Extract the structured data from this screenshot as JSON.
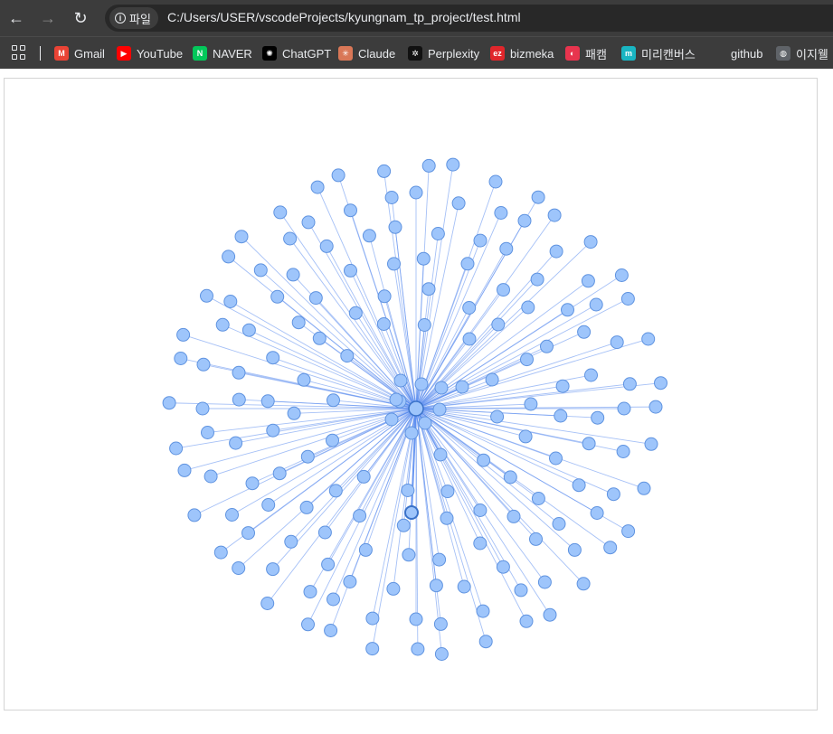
{
  "browser": {
    "site_chip_label": "파일",
    "url": "C:/Users/USER/vscodeProjects/kyungnam_tp_project/test.html",
    "nav": {
      "back_icon": "arrow-left-icon",
      "forward_icon": "arrow-right-icon",
      "reload_icon": "reload-icon"
    }
  },
  "bookmarks": [
    {
      "label": "Gmail",
      "icon": "gmail-icon",
      "color": "#ea4335",
      "glyph": "M"
    },
    {
      "label": "YouTube",
      "icon": "youtube-icon",
      "color": "#ff0000",
      "glyph": "▶"
    },
    {
      "label": "NAVER",
      "icon": "naver-icon",
      "color": "#03c75a",
      "glyph": "N"
    },
    {
      "label": "ChatGPT",
      "icon": "chatgpt-icon",
      "color": "#000000",
      "glyph": "✺"
    },
    {
      "label": "Claude",
      "icon": "claude-icon",
      "color": "#d97757",
      "glyph": "✳"
    },
    {
      "label": "Perplexity",
      "icon": "perplexity-icon",
      "color": "#111111",
      "glyph": "✲"
    },
    {
      "label": "bizmeka",
      "icon": "bizmeka-icon",
      "color": "#e0262b",
      "glyph": "ez"
    },
    {
      "label": "패캠",
      "icon": "fastcampus-icon",
      "color": "#e8344e",
      "glyph": "◐"
    },
    {
      "label": "미리캔버스",
      "icon": "miricanvas-icon",
      "color": "#19b5c2",
      "glyph": "m"
    },
    {
      "label": "github",
      "icon": "github-icon",
      "color": "#3c3c3c",
      "glyph": ""
    },
    {
      "label": "이지웰",
      "icon": "globe-icon",
      "color": "#5f6368",
      "glyph": "◍"
    }
  ],
  "graph": {
    "node_fill": "#9ec5fb",
    "node_stroke": "#5f93e0",
    "link_color": "#5b8def",
    "center_fill": "#9ec5fb",
    "selected_stroke": "#3a72c9"
  }
}
